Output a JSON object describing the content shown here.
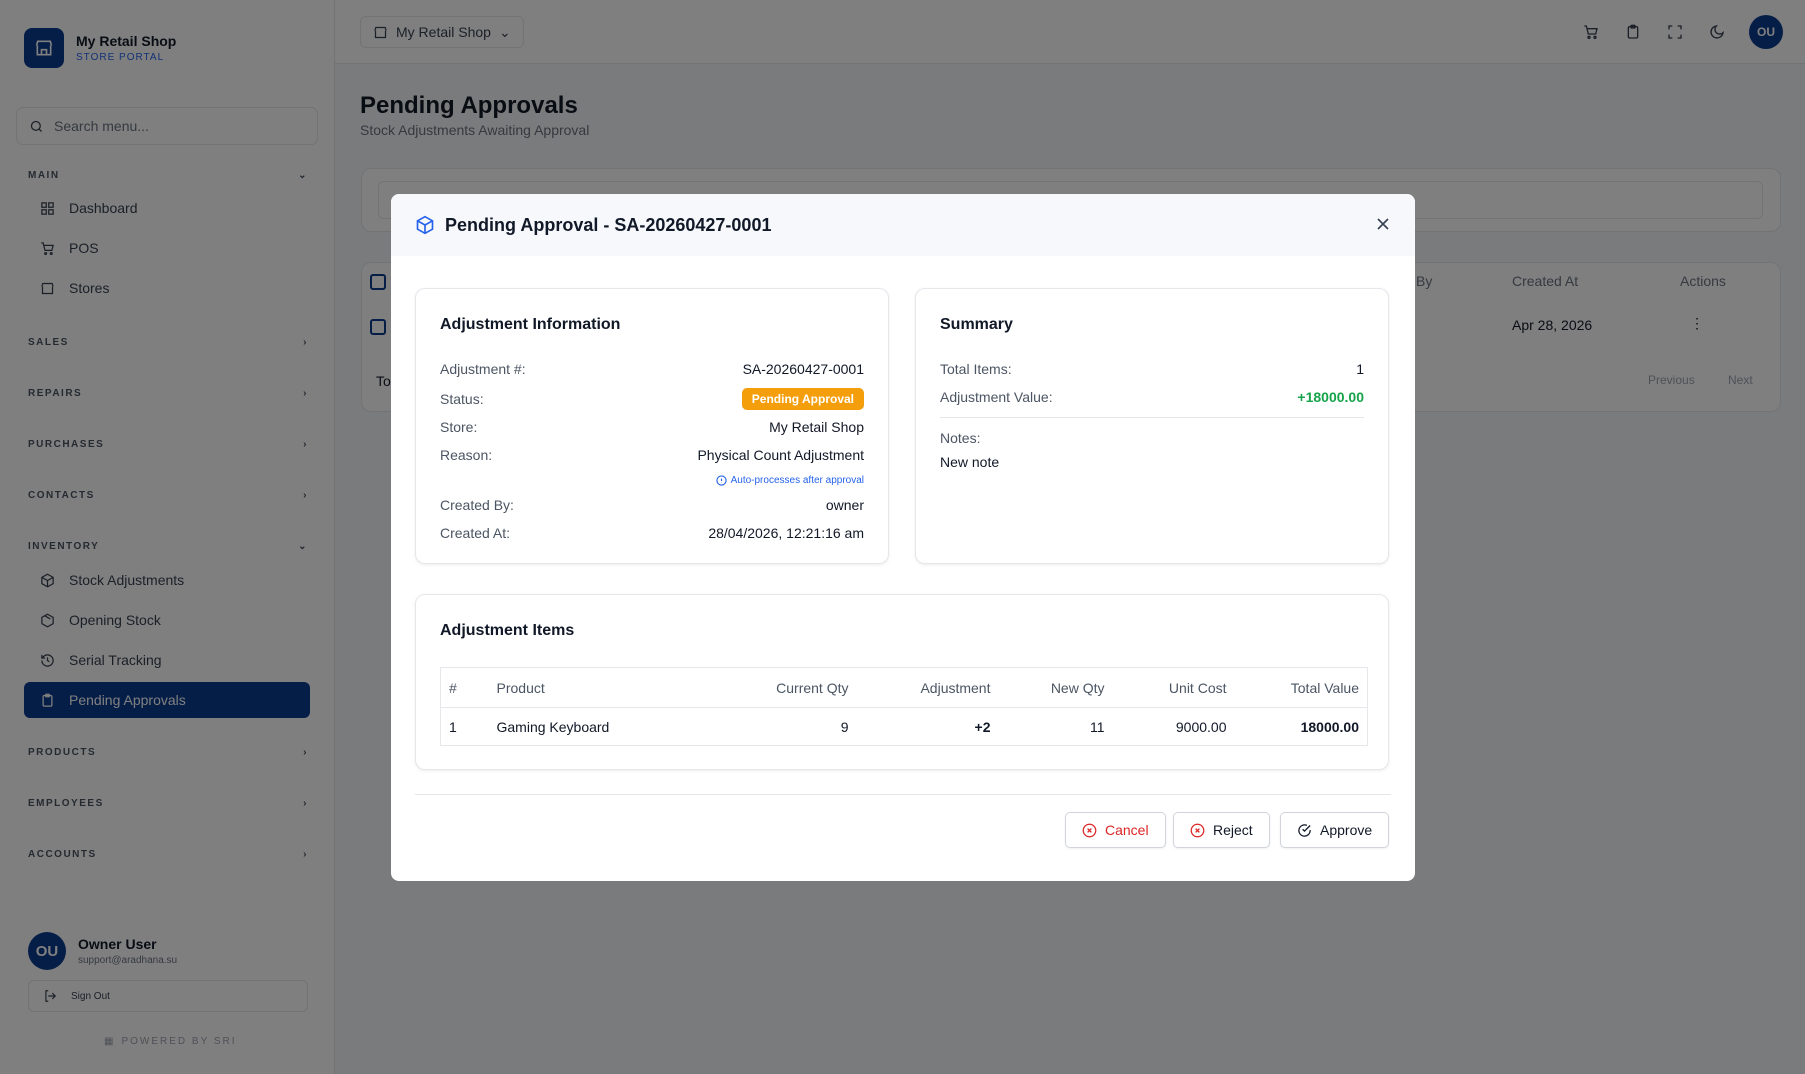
{
  "brand": {
    "name": "My Retail Shop",
    "subtitle": "STORE PORTAL"
  },
  "sidebar": {
    "search_placeholder": "Search menu...",
    "sections": {
      "main": "MAIN",
      "sales": "SALES",
      "repairs": "REPAIRS",
      "purchases": "PURCHASES",
      "contacts": "CONTACTS",
      "inventory": "INVENTORY",
      "products": "PRODUCTS",
      "employees": "EMPLOYEES",
      "accounts": "ACCOUNTS"
    },
    "items": {
      "dashboard": "Dashboard",
      "pos": "POS",
      "stores": "Stores",
      "stock_adjustments": "Stock Adjustments",
      "opening_stock": "Opening Stock",
      "serial_tracking": "Serial Tracking",
      "pending_approvals": "Pending Approvals"
    },
    "user": {
      "initials": "OU",
      "name": "Owner User",
      "email": "support@aradhana.su"
    },
    "sign_out": "Sign Out",
    "powered_by": "POWERED BY SRI"
  },
  "topbar": {
    "store": "My Retail Shop",
    "avatar": "OU"
  },
  "page": {
    "title": "Pending Approvals",
    "subtitle": "Stock Adjustments Awaiting Approval",
    "table": {
      "col_by": "By",
      "col_created_at": "Created At",
      "col_actions": "Actions",
      "row_created_at": "Apr 28, 2026",
      "total_prefix": "To",
      "previous": "Previous",
      "next": "Next"
    }
  },
  "modal": {
    "title": "Pending Approval - SA-20260427-0001",
    "info": {
      "title": "Adjustment Information",
      "adjustment_label": "Adjustment #:",
      "adjustment_value": "SA-20260427-0001",
      "status_label": "Status:",
      "status_value": "Pending Approval",
      "store_label": "Store:",
      "store_value": "My Retail Shop",
      "reason_label": "Reason:",
      "reason_value": "Physical Count Adjustment",
      "reason_hint": "Auto-processes after approval",
      "created_by_label": "Created By:",
      "created_by_value": "owner",
      "created_at_label": "Created At:",
      "created_at_value": "28/04/2026, 12:21:16 am"
    },
    "summary": {
      "title": "Summary",
      "total_items_label": "Total Items:",
      "total_items_value": "1",
      "adjustment_value_label": "Adjustment Value:",
      "adjustment_value_value": "+18000.00",
      "notes_label": "Notes:",
      "notes_value": "New note"
    },
    "items": {
      "title": "Adjustment Items",
      "headers": {
        "num": "#",
        "product": "Product",
        "current_qty": "Current Qty",
        "adjustment": "Adjustment",
        "new_qty": "New Qty",
        "unit_cost": "Unit Cost",
        "total_value": "Total Value"
      },
      "rows": [
        {
          "num": "1",
          "product": "Gaming Keyboard",
          "current_qty": "9",
          "adjustment": "+2",
          "new_qty": "11",
          "unit_cost": "9000.00",
          "total_value": "18000.00"
        }
      ]
    },
    "buttons": {
      "cancel": "Cancel",
      "reject": "Reject",
      "approve": "Approve"
    }
  },
  "colors": {
    "primary": "#0b3d91",
    "warning": "#f59e0b",
    "success": "#16a34a",
    "danger": "#dc2626",
    "link": "#2563eb"
  }
}
